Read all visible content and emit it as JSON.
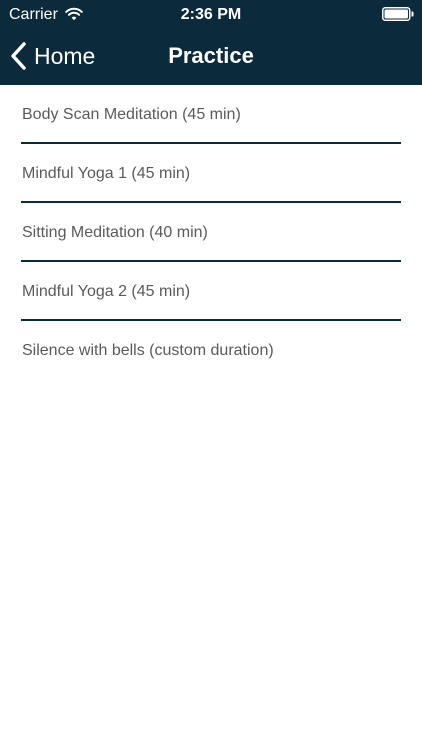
{
  "status_bar": {
    "carrier": "Carrier",
    "time": "2:36 PM",
    "icons": [
      "wifi-icon",
      "battery-icon"
    ]
  },
  "nav": {
    "back_label": "Home",
    "back_icon": "chevron-left-icon",
    "title": "Practice"
  },
  "colors": {
    "header_background": "#0b2a3c",
    "divider": "#0b2a3c",
    "item_text": "#5a5a5a",
    "background": "#ffffff"
  },
  "practice_list": {
    "items": [
      {
        "label": "Body Scan Meditation (45 min)"
      },
      {
        "label": "Mindful Yoga 1 (45 min)"
      },
      {
        "label": "Sitting Meditation (40 min)"
      },
      {
        "label": "Mindful Yoga 2 (45 min)"
      },
      {
        "label": "Silence with bells (custom duration)"
      }
    ]
  }
}
